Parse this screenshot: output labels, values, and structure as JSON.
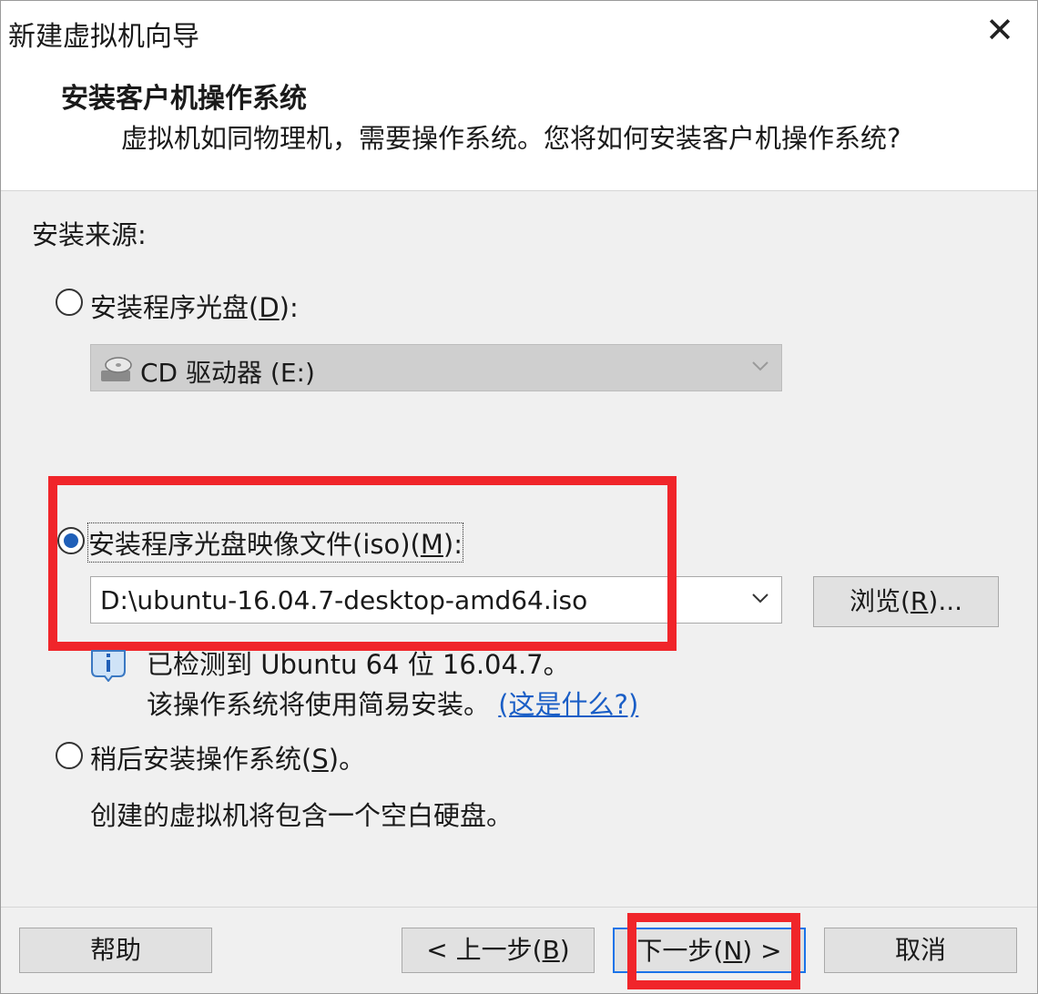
{
  "window": {
    "title": "新建虚拟机向导",
    "close_glyph": "✕"
  },
  "header": {
    "title": "安装客户机操作系统",
    "subtitle": "虚拟机如同物理机，需要操作系统。您将如何安装客户机操作系统?"
  },
  "install_source": {
    "label": "安装来源:",
    "option_disc": {
      "label_pre": "安装程序光盘(",
      "mnemonic": "D",
      "label_post": "):",
      "selected": false
    },
    "disc_drive": {
      "value": "CD 驱动器 (E:)",
      "icon": "cd-drive-icon"
    },
    "option_iso": {
      "label_pre": "安装程序光盘映像文件(iso)(",
      "mnemonic": "M",
      "label_post": "):",
      "selected": true
    },
    "iso_path": {
      "value": "D:\\ubuntu-16.04.7-desktop-amd64.iso"
    },
    "browse_button": {
      "label_pre": "浏览(",
      "mnemonic": "R",
      "label_post": ")..."
    },
    "detection": {
      "line1": "已检测到 Ubuntu 64 位 16.04.7。",
      "line2": "该操作系统将使用简易安装。",
      "link": "(这是什么?)",
      "icon": "info-icon"
    },
    "option_later": {
      "label_pre": "稍后安装操作系统(",
      "mnemonic": "S",
      "label_post": ")。",
      "selected": false
    },
    "later_note": "创建的虚拟机将包含一个空白硬盘。"
  },
  "footer": {
    "help": "帮助",
    "back": {
      "label_pre": "< 上一步(",
      "mnemonic": "B",
      "label_post": ")"
    },
    "next": {
      "label_pre": "下一步(",
      "mnemonic": "N",
      "label_post": ") >"
    },
    "cancel": "取消"
  },
  "colors": {
    "highlight": "#f0252a",
    "radio_selected": "#1f5fb8",
    "link": "#1a5ec6",
    "focus": "#1a73e8"
  }
}
